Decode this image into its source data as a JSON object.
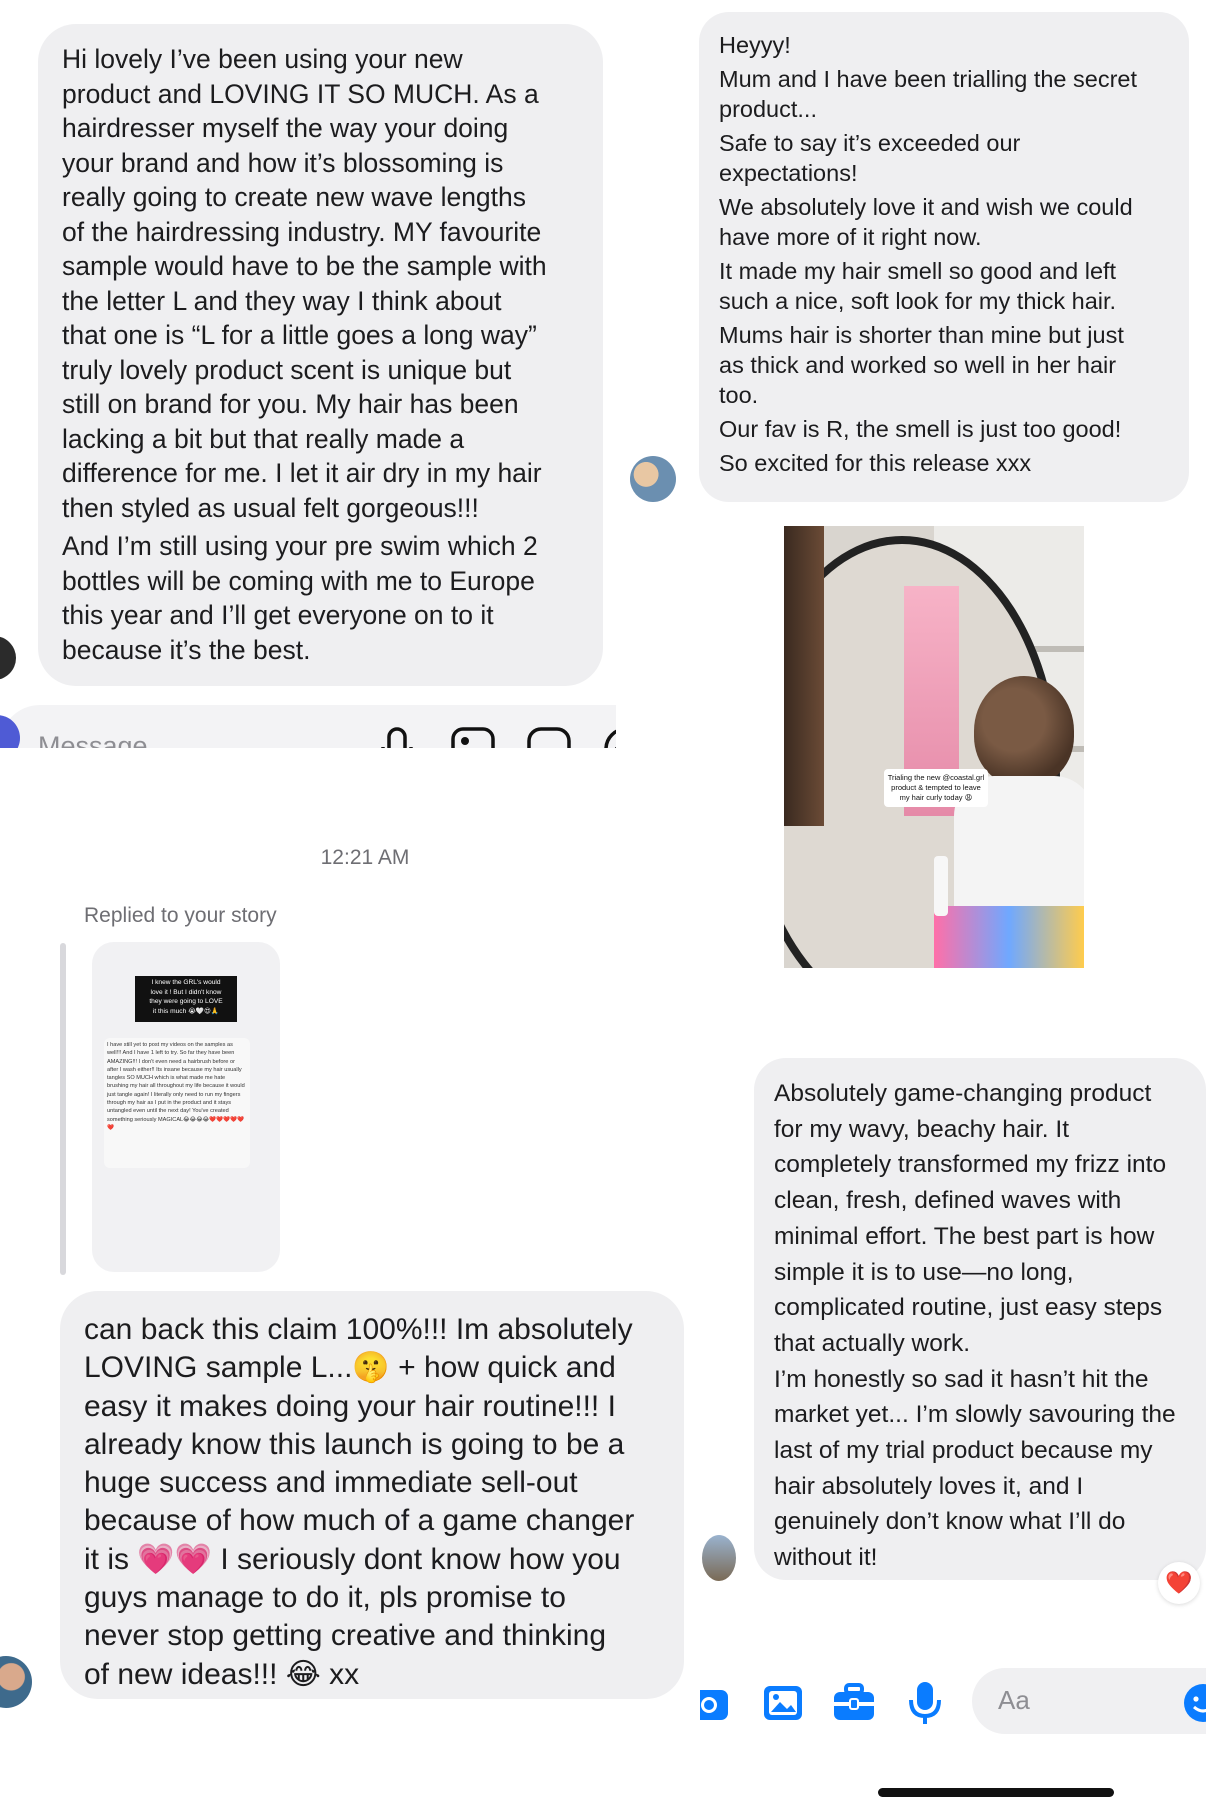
{
  "panel_a": {
    "message": "Hi lovely I’ve been using your new\nproduct and LOVING IT SO MUCH. As a\nhairdresser myself the way your doing\nyour brand and how it’s blossoming is\nreally going to create new wave lengths\nof the hairdressing industry. MY favourite\nsample would have to be the sample with\nthe letter L and they way I think about\nthat one is “L for a little goes a long way”\ntruly lovely product scent is unique but\nstill on brand for you. My hair has been\nlacking a bit but that really made a\ndifference for me. I let it air dry in my hair\nthen styled as usual felt gorgeous!!!",
    "message_2": "And I’m still using your pre swim which 2\nbottles will be coming with me to Europe\nthis year and I’ll get everyone on to it\nbecause it’s the best.",
    "composer_placeholder": "Message",
    "icons": [
      "mic-icon",
      "image-icon",
      "sticker-icon",
      "add-icon"
    ]
  },
  "panel_b": {
    "lines": [
      "Heyyy!",
      "Mum and I have been trialling the secret\nproduct...",
      "Safe to say it’s exceeded our\nexpectations!",
      "We absolutely love it and wish we could\nhave more of it right now.",
      "It made my hair smell so good and left\nsuch a nice, soft look for my thick hair.",
      "Mums hair is shorter than mine but just\nas thick and worked so well in her hair\ntoo.",
      "Our fav is R, the smell is just too good!",
      "So excited for this release xxx"
    ],
    "photo_caption": "Trialing the new @coastal.grl\nproduct & tempted to leave\nmy hair curly today 😩"
  },
  "panel_c": {
    "timestamp": "12:21 AM",
    "story_reply_label": "Replied to your story",
    "story_headline": "I knew the GRL's would\nlove it ! But I didn't know\nthey were going to LOVE\nit this much 😭🤍😍🙏",
    "story_body": "I have still yet to post my videos on the samples as well!!! And I have 1 left to try. So far they have been AMAZING!!! I don't even need a hairbrush before or after I wash either!! Its insane because my hair usually tangles SO MUCH which is what made me hate brushing my hair all throughout my life because it would just tangle again! I literally only need to run my fingers through my hair as I put in the product and it stays untangled even until the next day! You've created something seriously MAGICAL😂😂😂😂❤️❤️❤️❤️❤️❤️",
    "message": "can back this claim 100%!!! Im absolutely\nLOVING sample L...🤫 + how quick and\neasy it makes doing your hair routine!!! I\nalready know this launch is going to be a\nhuge success and immediate sell-out\nbecause of how much of a game changer\nit is 💗💗 I seriously dont know how you\nguys manage to do it, pls promise to\nnever stop getting creative and thinking\nof new ideas!!! 😂 xx"
  },
  "panel_d": {
    "message": "Absolutely game-changing product\nfor my wavy, beachy hair. It\ncompletely transformed my frizz into\nclean, fresh, defined waves with\nminimal effort. The best part is how\nsimple it is to use—no long,\ncomplicated routine, just easy steps\nthat actually work.",
    "message_2": "I’m honestly so sad it hasn’t hit the\nmarket yet... I’m slowly savouring the\nlast of my trial product because my\nhair absolutely loves it, and I\ngenuinely don’t know what I’ll do\nwithout it!",
    "reaction": "❤️",
    "composer_placeholder": "Aa",
    "icons": [
      "camera-icon",
      "image-icon",
      "briefcase-icon",
      "mic-icon",
      "emoji-icon"
    ]
  },
  "colors": {
    "bubble_bg": "#efeff1",
    "text": "#1c1c1e",
    "secondary_text": "#6e6e73",
    "messenger_blue": "#0a7cff",
    "instagram_purple": "#6b4cf6"
  }
}
